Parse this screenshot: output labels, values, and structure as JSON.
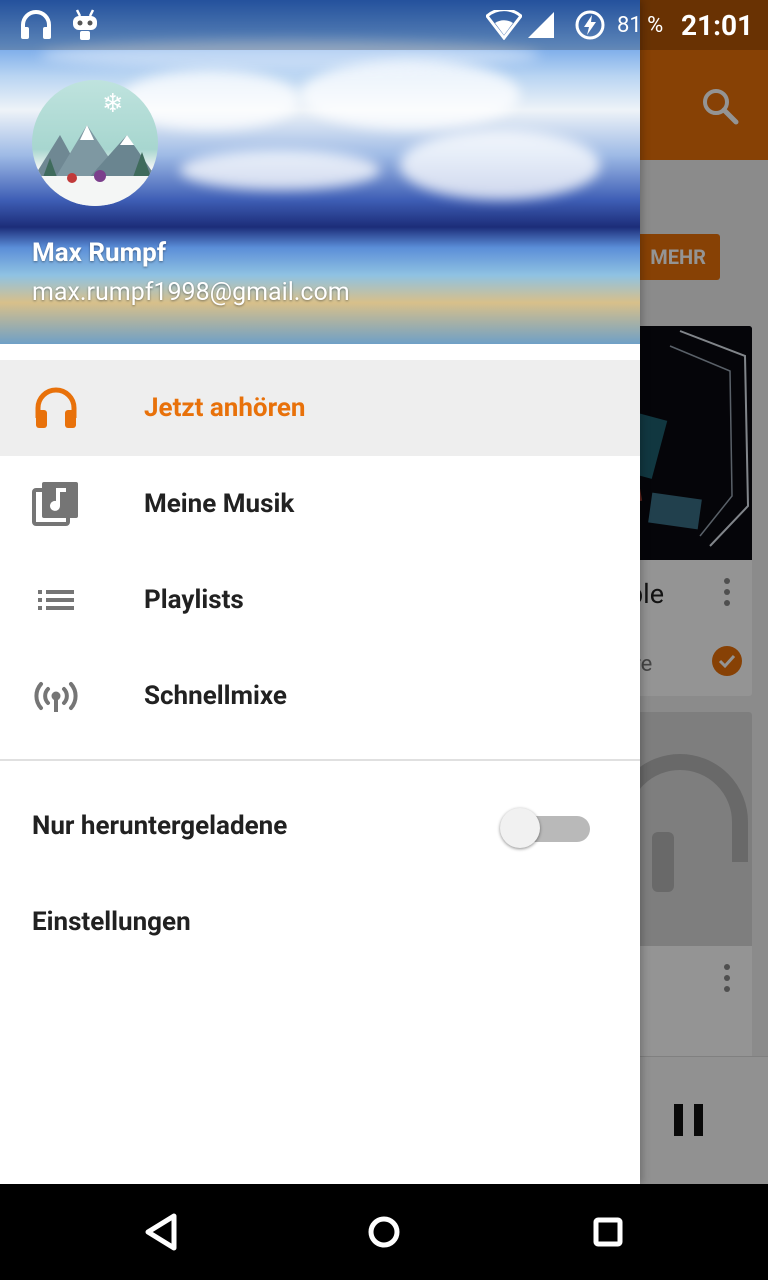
{
  "status_bar": {
    "battery_percent": "81 %",
    "time": "21:01",
    "icons": [
      "headphones-icon",
      "cyanogen-bot-icon",
      "wifi-icon",
      "signal-icon",
      "battery-charging-icon"
    ]
  },
  "background": {
    "more_button_label": "MEHR",
    "card1_title_fragment": "ble",
    "card1_subtitle_fragment": "ire",
    "accent_color": "#e8710a"
  },
  "drawer": {
    "header": {
      "user_name": "Max Rumpf",
      "user_email": "max.rumpf1998@gmail.com"
    },
    "nav_items": [
      {
        "label": "Jetzt anhören",
        "icon": "headphones-icon",
        "selected": true
      },
      {
        "label": "Meine Musik",
        "icon": "music-library-icon",
        "selected": false
      },
      {
        "label": "Playlists",
        "icon": "list-icon",
        "selected": false
      },
      {
        "label": "Schnellmixe",
        "icon": "radio-broadcast-icon",
        "selected": false
      }
    ],
    "settings": {
      "downloaded_only_label": "Nur heruntergeladene",
      "downloaded_only_on": false,
      "settings_label": "Einstellungen"
    },
    "colors": {
      "selected_text": "#e8710a",
      "selected_background": "#eeeeee",
      "icon_gray": "#757575"
    }
  },
  "nav_bar": {
    "buttons": [
      "back-icon",
      "home-icon",
      "recents-icon"
    ]
  }
}
